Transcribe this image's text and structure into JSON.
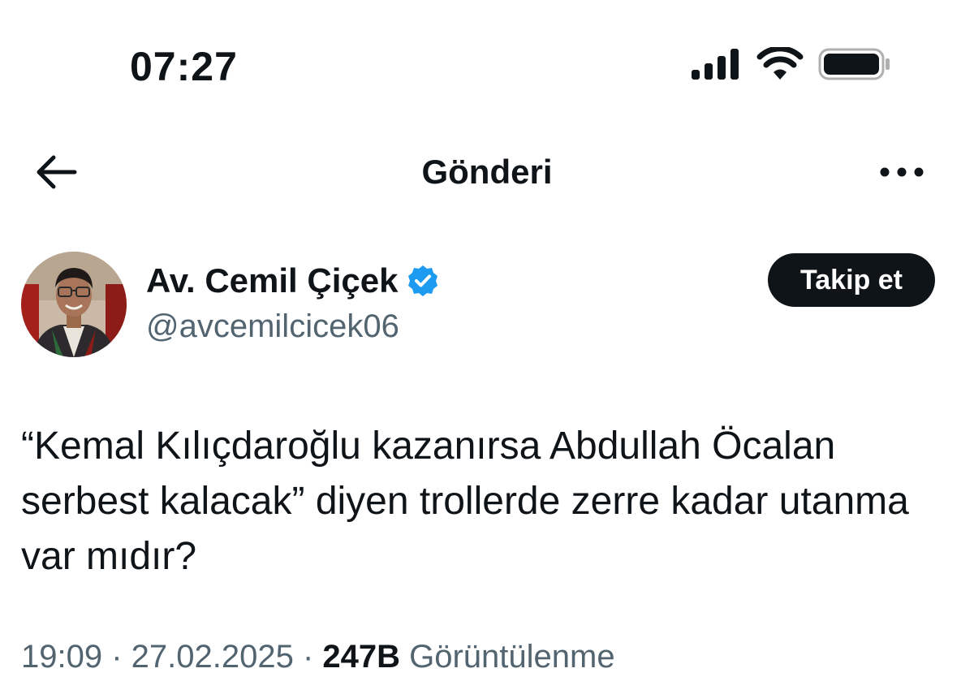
{
  "status_bar": {
    "time": "07:27",
    "icons": [
      "cellular-signal-icon",
      "wifi-icon",
      "battery-icon"
    ]
  },
  "header": {
    "back_icon": "arrow-left-icon",
    "title": "Gönderi",
    "more_icon": "more-horizontal-icon"
  },
  "author": {
    "name": "Av. Cemil Çiçek",
    "verified": true,
    "verified_color": "#1d9bf0",
    "handle": "@avcemilcicek06",
    "follow_label": "Takip et"
  },
  "tweet": {
    "text": "“Kemal Kılıçdaroğlu kazanırsa Abdullah Öcalan serbest kalacak” diyen trollerde zerre kadar utanma var mıdır?",
    "meta": {
      "time_date": "19:09 · 27.02.2025",
      "separator": " · ",
      "views_count": "247B",
      "views_label": " Görüntülenme"
    }
  },
  "colors": {
    "text": "#0f1419",
    "secondary": "#536471",
    "button_bg": "#0f1419",
    "button_text": "#ffffff"
  }
}
